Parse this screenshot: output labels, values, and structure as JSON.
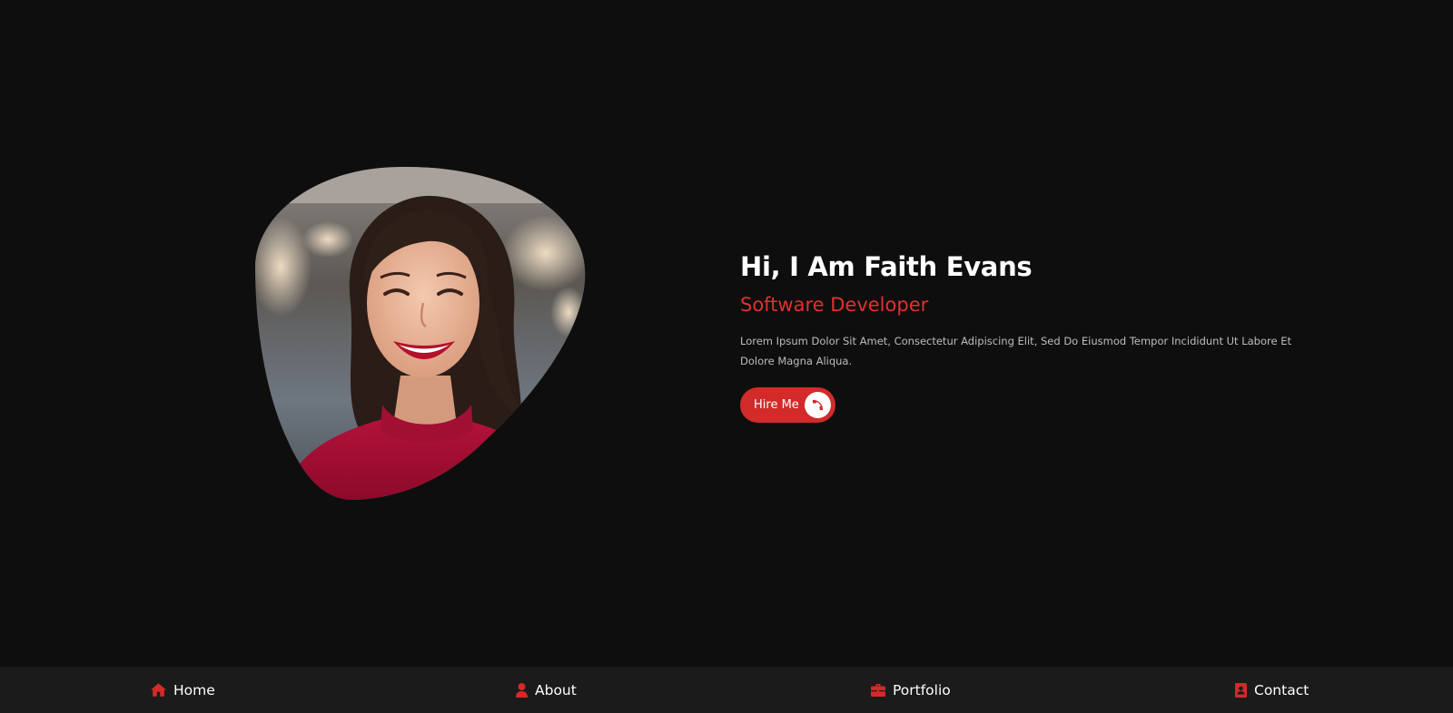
{
  "hero": {
    "title": "Hi, I Am Faith Evans",
    "role": "Software Developer",
    "description": "Lorem Ipsum Dolor Sit Amet, Consectetur Adipiscing Elit, Sed Do Eiusmod Tempor Incididunt Ut Labore Et Dolore Magna Aliqua.",
    "hire_label": "Hire Me",
    "hire_icon": "phone-icon",
    "photo_alt": "Smiling woman in red top"
  },
  "nav": {
    "items": [
      {
        "label": "Home",
        "icon": "home-icon"
      },
      {
        "label": "About",
        "icon": "user-icon"
      },
      {
        "label": "Portfolio",
        "icon": "briefcase-icon"
      },
      {
        "label": "Contact",
        "icon": "contact-card-icon"
      }
    ]
  },
  "colors": {
    "background": "#0e0e0e",
    "nav_background": "#1b1b1b",
    "accent": "#d32a2a",
    "text": "#ffffff",
    "muted_text": "#bdbdbd"
  }
}
